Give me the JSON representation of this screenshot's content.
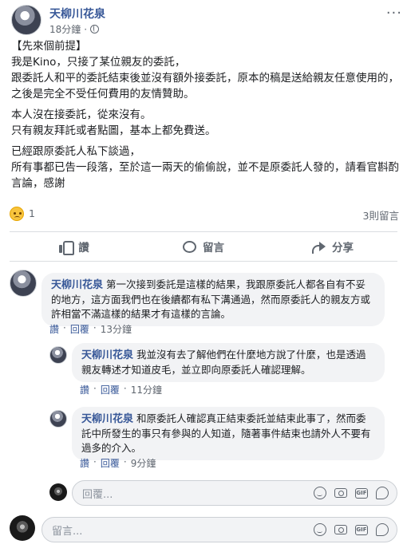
{
  "post": {
    "author": "天柳川花泉",
    "time": "18分鐘",
    "paragraphs": [
      "【先來個前提】\n我是Kino，只接了某位親友的委託，\n跟委託人和平的委託結束後並沒有額外接委託，原本的稿是送給親友任意使用的，之後是完全不受任何費用的友情贊助。",
      "本人沒在接委託，從來沒有。\n只有親友拜託或者點圖，基本上都免費送。",
      "已經跟原委託人私下談過，\n所有事都已告一段落，至於這一兩天的偷偷說，並不是原委託人發的，請看官斟酌言論，感謝"
    ],
    "reaction_count": "1",
    "comment_count": "3則留言"
  },
  "actions": {
    "like": "讚",
    "comment": "留言",
    "share": "分享"
  },
  "comments": [
    {
      "author": "天柳川花泉",
      "text": "第一次接到委託是這樣的結果，我跟原委託人都各自有不妥的地方，這方面我們也在後續都有私下溝通過，然而原委託人的親友方或許相當不滿這樣的結果才有這樣的言論。",
      "like": "讚",
      "reply": "回覆",
      "time": "13分鐘"
    },
    {
      "author": "天柳川花泉",
      "text": "我並沒有去了解他們在什麼地方說了什麼，也是透過親友轉述才知道皮毛，並立即向原委託人確認理解。",
      "like": "讚",
      "reply": "回覆",
      "time": "11分鐘"
    },
    {
      "author": "天柳川花泉",
      "text": "和原委託人確認真正結束委託並結束此事了，然而委託中所發生的事只有參與的人知道，隨著事件結束也請外人不要有過多的介入。",
      "like": "讚",
      "reply": "回覆",
      "time": "9分鐘"
    }
  ],
  "reply_input": {
    "placeholder": "回覆..."
  },
  "comment_input": {
    "placeholder": "留言..."
  },
  "icons": {
    "more": "more-options-icon",
    "privacy": "globe-icon",
    "reaction": "sad-reaction-icon",
    "like": "thumbs-up-icon",
    "comment": "comment-bubble-icon",
    "share": "share-arrow-icon",
    "emoji": "emoji-icon",
    "camera": "camera-icon",
    "gif": "gif-icon",
    "sticker": "sticker-icon"
  },
  "colors": {
    "author_link": "#385898",
    "secondary_text": "#606770",
    "bubble_bg": "#f2f3f5",
    "divider": "#dadde1"
  }
}
